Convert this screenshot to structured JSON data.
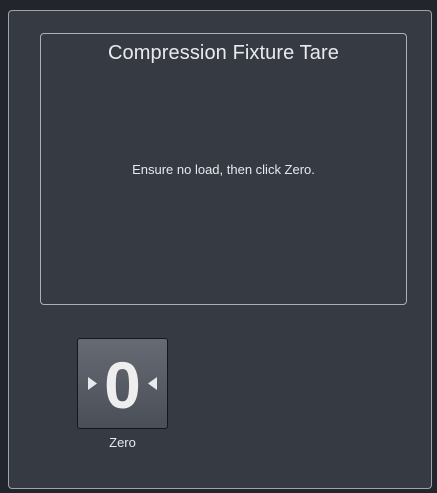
{
  "dialog": {
    "title": "Compression Fixture Tare",
    "instruction": "Ensure no load, then click Zero."
  },
  "zero_button": {
    "glyph": "0",
    "label": "Zero",
    "icon": "zero-tare-icon"
  },
  "colors": {
    "background": "#363a42",
    "border": "#aab0b8",
    "text": "#e8eaed",
    "button": "#5a5f67"
  }
}
